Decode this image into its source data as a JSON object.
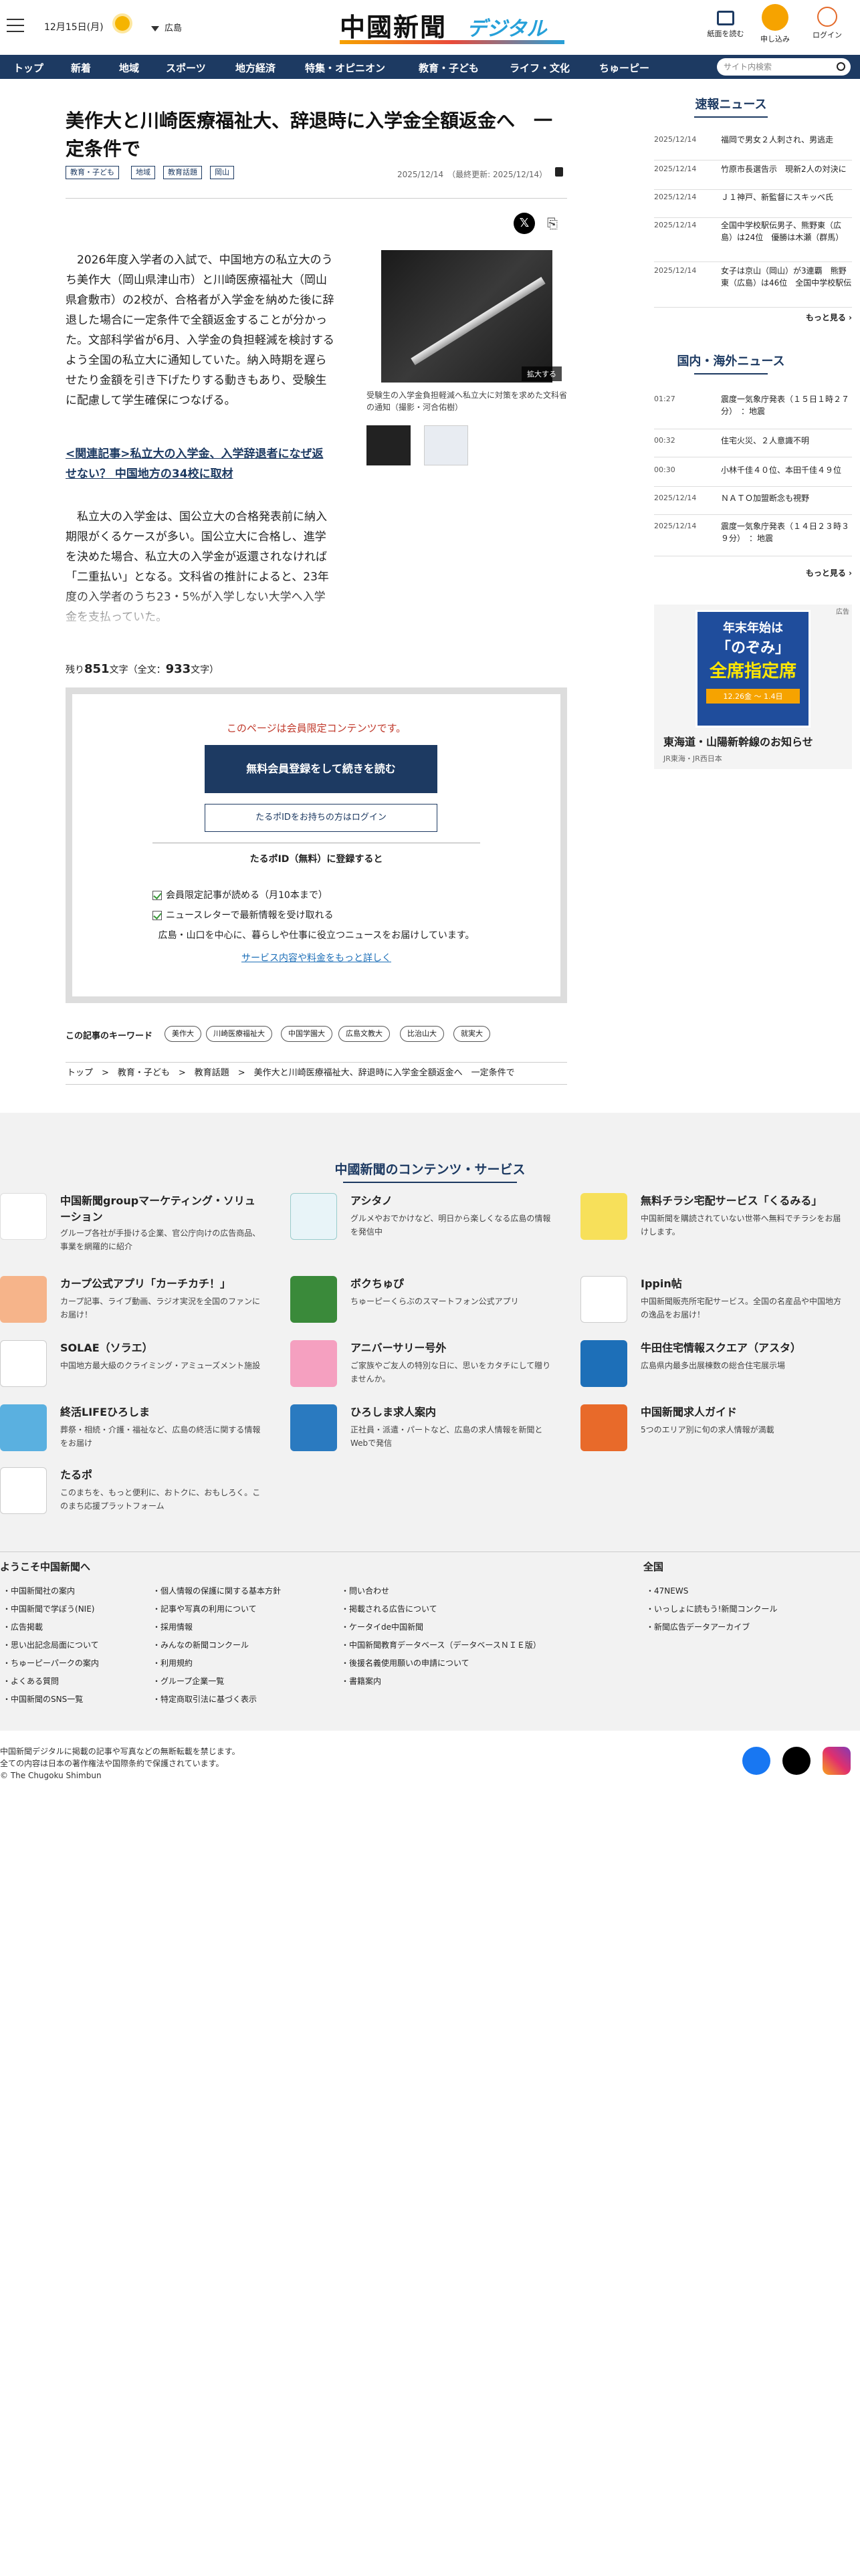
{
  "header": {
    "date": "12月15日(月)",
    "region": "広島",
    "logo_main": "中國新聞",
    "logo_sub": "デジタル",
    "read_paper": "紙面を読む",
    "subscribe": "申し込み",
    "login": "ログイン"
  },
  "nav": {
    "items": [
      "トップ",
      "新着",
      "地域",
      "スポーツ",
      "地方経済",
      "特集・オピニオン",
      "教育・子ども",
      "ライフ・文化",
      "ちゅーピー"
    ],
    "search_placeholder": "サイト内検索"
  },
  "article": {
    "title": "美作大と川崎医療福祉大、辞退時に入学金全額返金へ　一定条件で",
    "tags": [
      "教育・子ども",
      "地域",
      "教育話題",
      "岡山"
    ],
    "date": "2025/12/14　（最終更新: 2025/12/14）",
    "p1": "　2026年度入学者の入試で、中国地方の私立大のうち美作大（岡山県津山市）と川崎医療福祉大（岡山県倉敷市）の2校が、合格者が入学金を納めた後に辞退した場合に一定条件で全額返金することが分かった。文部科学省が6月、入学金の負担軽減を検討するよう全国の私立大に通知していた。納入時期を遅らせたり金額を引き下げたりする動きもあり、受験生に配慮して学生確保につなげる。",
    "related": "<関連記事>私立大の入学金、入学辞退者になぜ返せない？ 中国地方の34校に取材",
    "p2": "　私立大の入学金は、国公立大の合格発表前に納入期限がくるケースが多い。国公立大に合格し、進学を決めた場合、私立大の入学金が返還されなければ「二重払い」となる。文科省の推計によると、23年度の入学者のうち23・5%が入学しない大学へ入学金を支払っていた。",
    "zoom": "拡大する",
    "caption": "受験生の入学金負担軽減へ私立大に対策を求めた文科省の通知（撮影・河合佑樹）",
    "remain_prefix": "残り",
    "remain_num": "851",
    "remain_mid": "文字（全文：",
    "remain_total": "933",
    "remain_suffix": "文字）"
  },
  "member": {
    "notice": "このページは会員限定コンテンツです。",
    "register": "無料会員登録をして続きを読む",
    "login": "たるポIDをお持ちの方はログイン",
    "subhead": "たるポID（無料）に登録すると",
    "benefit1": "会員限定記事が読める（月10本まで）",
    "benefit2": "ニュースレターで最新情報を受け取れる",
    "desc": "広島・山口を中心に、暮らしや仕事に役立つニュースをお届けしています。",
    "more": "サービス内容や料金をもっと詳しく"
  },
  "keywords": {
    "label": "この記事のキーワード",
    "items": [
      "美作大",
      "川崎医療福祉大",
      "中国学園大",
      "広島文教大",
      "比治山大",
      "就実大"
    ]
  },
  "breadcrumb": "トップ　>　教育・子ども　>　教育話題　>　美作大と川崎医療福祉大、辞退時に入学金全額返金へ　一定条件で",
  "sidebar": {
    "breaking_title": "速報ニュース",
    "breaking": [
      {
        "t": "2025/12/14",
        "x": "福岡で男女２人刺され、男逃走"
      },
      {
        "t": "2025/12/14",
        "x": "竹原市長選告示　現新2人の対決に"
      },
      {
        "t": "2025/12/14",
        "x": "Ｊ１神戸、新監督にスキッベ氏"
      },
      {
        "t": "2025/12/14",
        "x": "全国中学校駅伝男子、熊野東（広島）は24位　優勝は木瀬（群馬）"
      },
      {
        "t": "2025/12/14",
        "x": "女子は京山（岡山）が3連覇　熊野東（広島）は46位　全国中学校駅伝"
      }
    ],
    "more1": "もっと見る",
    "world_title": "国内・海外ニュース",
    "world": [
      {
        "t": "01:27",
        "x": "震度一気象庁発表（１５日１時２７分）　：地震"
      },
      {
        "t": "00:32",
        "x": "住宅火災、２人意識不明"
      },
      {
        "t": "00:30",
        "x": "小林千佳４０位、本田千佳４９位"
      },
      {
        "t": "2025/12/14",
        "x": "ＮＡＴＯ加盟断念も視野"
      },
      {
        "t": "2025/12/14",
        "x": "震度一気象庁発表（１４日２３時３９分）　：地震"
      }
    ],
    "more2": "もっと見る",
    "ad_label": "広告",
    "ad_title": "東海道・山陽新幹線のお知らせ",
    "ad_sub": "JR東海・JR西日本",
    "ad_img_l1": "年末年始は",
    "ad_img_l2": "「のぞみ」",
    "ad_img_l3": "全席指定席",
    "ad_img_l4": "12.26金 ～ 1.4日"
  },
  "footer": {
    "head": "中國新聞のコンテンツ・サービス",
    "services": [
      {
        "n": "中国新聞groupマーケティング・ソリューション",
        "d": "グループ各社が手掛ける企業、官公庁向けの広告商品、事業を網羅的に紹介",
        "c": "#ffffff"
      },
      {
        "n": "アシタノ",
        "d": "グルメやおでかけなど、明日から楽しくなる広島の情報を発信中",
        "c": "#e8f4f8"
      },
      {
        "n": "無料チラシ宅配サービス「くるみる」",
        "d": "中国新聞を購読されていない世帯へ無料でチラシをお届けします。",
        "c": "#ffffff"
      },
      {
        "n": "カープ公式アプリ「カーチカチ！」",
        "d": "カープ記事、ライブ動画、ラジオ実況を全国のファンにお届け！",
        "c": "#f6b48a"
      },
      {
        "n": "ボクちゅぴ",
        "d": "ちゅーピーくらぶのスマートフォン公式アプリ",
        "c": "#3a8a3a"
      },
      {
        "n": "Ippin帖",
        "d": "中国新聞販売所宅配サービス。全国の名産品や中国地方の逸品をお届け！",
        "c": "#ffffff"
      },
      {
        "n": "SOLAE（ソラエ）",
        "d": "中国地方最大級のクライミング・アミューズメント施設",
        "c": "#ffffff"
      },
      {
        "n": "アニバーサリー号外",
        "d": "ご家族やご友人の特別な日に、思いをカタチにして贈りませんか。",
        "c": "#f5a0c0"
      },
      {
        "n": "牛田住宅情報スクエア（アスタ）",
        "d": "広島県内最多出展棟数の総合住宅展示場",
        "c": "#1d6fb8"
      },
      {
        "n": "終活LIFEひろしま",
        "d": "葬祭・相続・介護・福祉など、広島の終活に関する情報をお届け",
        "c": "#5ab0e0"
      },
      {
        "n": "ひろしま求人案内",
        "d": "正社員・派遣・パートなど、広島の求人情報を新聞とWebで発信",
        "c": "#2a7ac0"
      },
      {
        "n": "中国新聞求人ガイド",
        "d": "5つのエリア別に旬の求人情報が満載",
        "c": "#e86a2a"
      },
      {
        "n": "たるポ",
        "d": "このまちを、もっと便利に、おトクに、おもしろく。このまち応援プラットフォーム",
        "c": "#ffffff"
      }
    ],
    "sec1": "ようこそ中国新聞へ",
    "sec2": "全国",
    "col1": [
      "中国新聞社の案内",
      "中国新聞で学ぼう(NIE)",
      "広告掲載",
      "思い出記念局面について",
      "ちゅーピーパークの案内",
      "よくある質問",
      "中国新聞のSNS一覧"
    ],
    "col2": [
      "個人情報の保護に関する基本方針",
      "記事や写真の利用について",
      "採用情報",
      "みんなの新聞コンクール",
      "利用規約",
      "グループ企業一覧",
      "特定商取引法に基づく表示"
    ],
    "col3": [
      "問い合わせ",
      "掲載される広告について",
      "ケータイde中国新聞",
      "中国新聞教育データベース（データベースＮＩＥ版）",
      "後援名義使用願いの申請について",
      "書籍案内"
    ],
    "col4": [
      "47NEWS",
      "いっしょに読もう!新聞コンクール",
      "新聞広告データアーカイブ"
    ],
    "copy1": "中国新聞デジタルに掲載の記事や写真などの無断転載を禁じます。",
    "copy2": "全ての内容は日本の著作権法や国際条約で保護されています。",
    "copy3": "© The Chugoku Shimbun"
  },
  "colors": {
    "navy": "#1d3a62",
    "accent": "#c0392b",
    "sub": "#f6a300"
  }
}
